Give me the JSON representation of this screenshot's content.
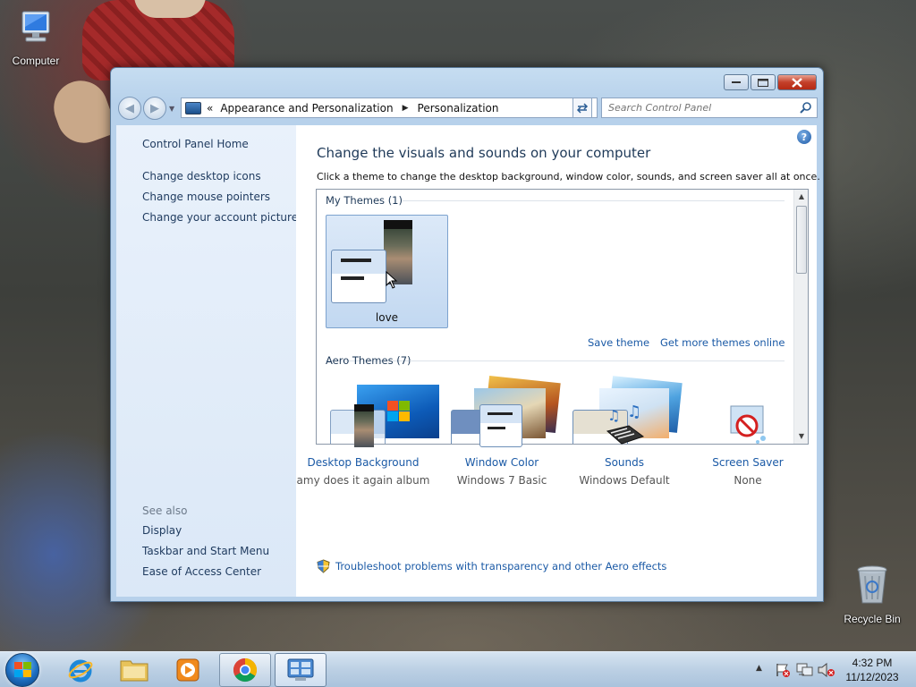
{
  "desktop": {
    "icons": [
      {
        "label": "Computer"
      },
      {
        "label": "Recycle Bin"
      }
    ]
  },
  "window": {
    "address": {
      "crumbs": [
        "Appearance and Personalization",
        "Personalization"
      ]
    },
    "search": {
      "placeholder": "Search Control Panel"
    },
    "left_pane": {
      "home": "Control Panel Home",
      "tasks": [
        "Change desktop icons",
        "Change mouse pointers",
        "Change your account picture"
      ],
      "see_also_header": "See also",
      "see_also": [
        "Display",
        "Taskbar and Start Menu",
        "Ease of Access Center"
      ]
    },
    "main": {
      "title": "Change the visuals and sounds on your computer",
      "description": "Click a theme to change the desktop background, window color, sounds, and screen saver all at once.",
      "my_themes_header": "My Themes (1)",
      "selected_theme": "love",
      "save_theme": "Save theme",
      "get_more": "Get more themes online",
      "aero_themes_header": "Aero Themes (7)",
      "bottom": [
        {
          "title": "Desktop Background",
          "value": "amy does it again album"
        },
        {
          "title": "Window Color",
          "value": "Windows 7 Basic"
        },
        {
          "title": "Sounds",
          "value": "Windows Default"
        },
        {
          "title": "Screen Saver",
          "value": "None"
        }
      ],
      "troubleshoot": "Troubleshoot problems with transparency and other Aero effects"
    }
  },
  "taskbar": {
    "pinned": [
      "start-button",
      "internet-explorer",
      "windows-explorer",
      "media-player",
      "chrome",
      "control-panel"
    ],
    "clock": {
      "time": "4:32 PM",
      "date": "11/12/2023"
    }
  },
  "colors": {
    "link": "#1b5aa6",
    "title": "#1e3958",
    "left_pane_bg": "#e9f1fb"
  }
}
